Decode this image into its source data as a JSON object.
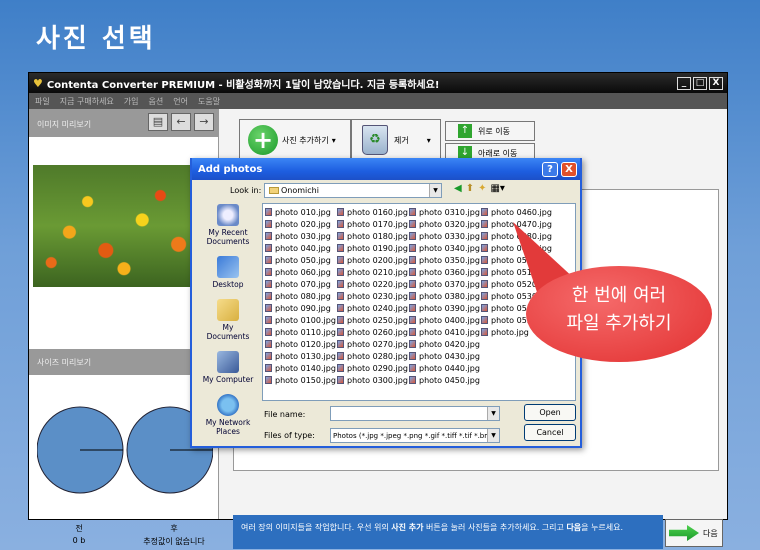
{
  "slide_title": "사진 선택",
  "app": {
    "title": "Contenta Converter PREMIUM - 비활성화까지 1달이 남았습니다. 지금 등록하세요!",
    "window_buttons": [
      "_",
      "□",
      "X"
    ],
    "menu": [
      "파일",
      "지금 구매하세요",
      "가입",
      "옵션",
      "언어",
      "도움말"
    ]
  },
  "left_panel": {
    "image_preview_label": "이미지 미리보기",
    "size_preview_label": "사이즈 미리보기",
    "before_label": "전",
    "before_value": "0 b",
    "after_label": "후",
    "after_value": "추정값이 없습니다"
  },
  "toolbar": {
    "add_photos_label": "사진 추가하기",
    "remove_label": "제거",
    "move_up_label": "위로 이동",
    "move_down_label": "아래로 이동"
  },
  "info_bar": {
    "text_1": "여러 장의 이미지들을 작업합니다. 우선 위의 ",
    "bold_1": "사진 추가",
    "text_2": " 버튼을 눌러 사진들을 추가하세요. 그리고 ",
    "bold_2": "다음",
    "text_3": "을 누르세요."
  },
  "next_button": "다음",
  "dialog": {
    "title": "Add photos",
    "help": "?",
    "close": "X",
    "look_in_label": "Look in:",
    "look_in_value": "Onomichi",
    "places": [
      "My Recent Documents",
      "Desktop",
      "My Documents",
      "My Computer",
      "My Network Places"
    ],
    "columns": [
      [
        "photo 010.jpg",
        "photo 020.jpg",
        "photo 030.jpg",
        "photo 040.jpg",
        "photo 050.jpg",
        "photo 060.jpg",
        "photo 070.jpg",
        "photo 080.jpg",
        "photo 090.jpg",
        "photo 0100.jpg",
        "photo 0110.jpg",
        "photo 0120.jpg",
        "photo 0130.jpg",
        "photo 0140.jpg",
        "photo 0150.jpg"
      ],
      [
        "photo 0160.jpg",
        "photo 0170.jpg",
        "photo 0180.jpg",
        "photo 0190.jpg",
        "photo 0200.jpg",
        "photo 0210.jpg",
        "photo 0220.jpg",
        "photo 0230.jpg",
        "photo 0240.jpg",
        "photo 0250.jpg",
        "photo 0260.jpg",
        "photo 0270.jpg",
        "photo 0280.jpg",
        "photo 0290.jpg",
        "photo 0300.jpg"
      ],
      [
        "photo 0310.jpg",
        "photo 0320.jpg",
        "photo 0330.jpg",
        "photo 0340.jpg",
        "photo 0350.jpg",
        "photo 0360.jpg",
        "photo 0370.jpg",
        "photo 0380.jpg",
        "photo 0390.jpg",
        "photo 0400.jpg",
        "photo 0410.jpg",
        "photo 0420.jpg",
        "photo 0430.jpg",
        "photo 0440.jpg",
        "photo 0450.jpg"
      ],
      [
        "photo 0460.jpg",
        "photo 0470.jpg",
        "photo 0480.jpg",
        "photo 0490.jpg",
        "photo 0500.jpg",
        "photo 0510.jpg",
        "photo 0520.jpg",
        "photo 0530.jpg",
        "photo 0540.jpg",
        "photo 0550.jpg",
        "photo.jpg"
      ]
    ],
    "file_name_label": "File name:",
    "file_name_value": "",
    "file_type_label": "Files of type:",
    "file_type_value": "Photos (*.jpg *.jpeg *.png *.gif *.tiff *.tif *.bmp *.jp",
    "open_label": "Open",
    "cancel_label": "Cancel"
  },
  "callout": {
    "line_1": "한 번에 여러",
    "line_2": "파일 추가하기"
  },
  "colors": {
    "accent": "#245edb",
    "info_bar": "#2d6fbf",
    "callout": "#e23030",
    "pie_fill": "#5b8fc7"
  }
}
